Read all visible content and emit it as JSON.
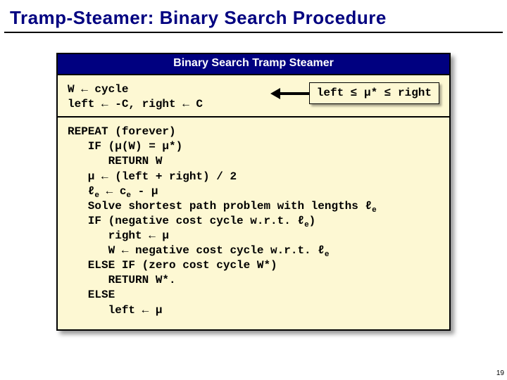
{
  "title": "Tramp-Steamer:  Binary Search Procedure",
  "box_header": "Binary Search Tramp Steamer",
  "init": {
    "line1": "W ← cycle",
    "line2": "left ← -C, right ← C"
  },
  "invariant": "left ≤ μ* ≤ right",
  "repeat": {
    "l1": "REPEAT (forever)",
    "l2": "   IF (μ(W) = μ*)",
    "l3": "      RETURN W",
    "l4": "   μ ← (left + right) / 2",
    "l5a": "   ℓ",
    "l5b": " ← c",
    "l5c": " - μ",
    "l6a": "   Solve shortest path problem with lengths ℓ",
    "l7a": "   IF (negative cost cycle w.r.t. ℓ",
    "l7b": ")",
    "l8": "      right ← μ",
    "l9a": "      W ← negative cost cycle w.r.t. ℓ",
    "l10": "   ELSE IF (zero cost cycle W*)",
    "l11": "      RETURN W*.",
    "l12": "   ELSE",
    "l13": "      left ← μ",
    "sub_e": "e"
  },
  "page_number": "19"
}
